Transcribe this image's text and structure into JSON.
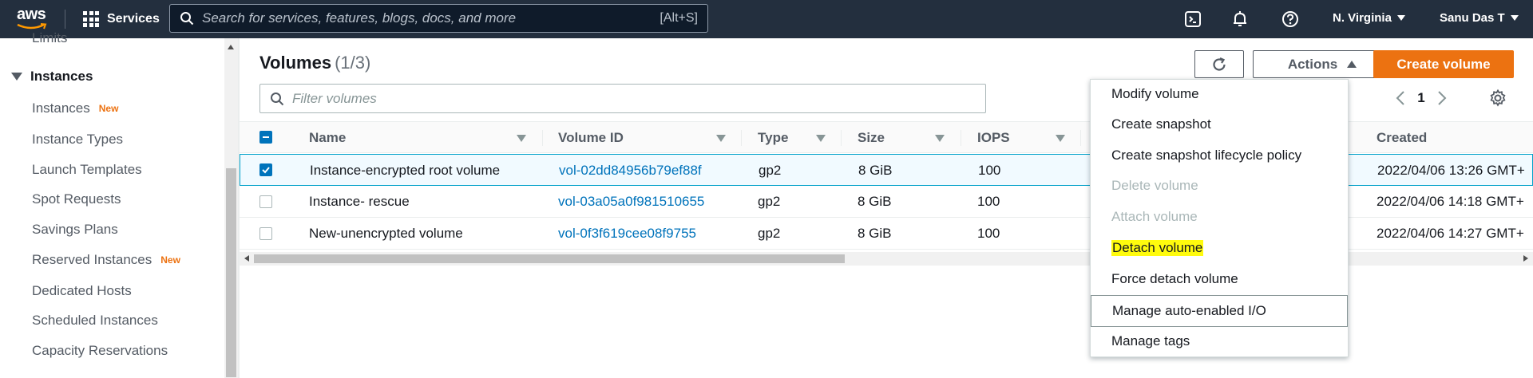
{
  "topnav": {
    "logo_text": "aws",
    "services_label": "Services",
    "search_placeholder": "Search for services, features, blogs, docs, and more",
    "search_shortcut": "[Alt+S]",
    "region": "N. Virginia",
    "user": "Sanu Das T"
  },
  "sidebar": {
    "cut_item": "Limits",
    "section_title": "Instances",
    "items": [
      {
        "label": "Instances",
        "badge": "New"
      },
      {
        "label": "Instance Types",
        "badge": ""
      },
      {
        "label": "Launch Templates",
        "badge": ""
      },
      {
        "label": "Spot Requests",
        "badge": ""
      },
      {
        "label": "Savings Plans",
        "badge": ""
      },
      {
        "label": "Reserved Instances",
        "badge": "New"
      },
      {
        "label": "Dedicated Hosts",
        "badge": ""
      },
      {
        "label": "Scheduled Instances",
        "badge": ""
      },
      {
        "label": "Capacity Reservations",
        "badge": ""
      }
    ]
  },
  "main": {
    "title": "Volumes",
    "count": "(1/3)",
    "actions_label": "Actions",
    "create_label": "Create volume",
    "filter_placeholder": "Filter volumes",
    "page_number": "1",
    "columns": [
      "Name",
      "Volume ID",
      "Type",
      "Size",
      "IOPS",
      "Created"
    ],
    "rows": [
      {
        "selected": true,
        "name": "Instance-encrypted root volume",
        "volume_id": "vol-02dd84956b79ef88f",
        "type": "gp2",
        "size": "8 GiB",
        "iops": "100",
        "created": "2022/04/06 13:26 GMT+"
      },
      {
        "selected": false,
        "name": "Instance- rescue",
        "volume_id": "vol-03a05a0f981510655",
        "type": "gp2",
        "size": "8 GiB",
        "iops": "100",
        "created": "2022/04/06 14:18 GMT+"
      },
      {
        "selected": false,
        "name": "New-unencrypted volume",
        "volume_id": "vol-0f3f619cee08f9755",
        "type": "gp2",
        "size": "8 GiB",
        "iops": "100",
        "created": "2022/04/06 14:27 GMT+"
      }
    ]
  },
  "actions_menu": [
    {
      "label": "Modify volume",
      "state": "enabled"
    },
    {
      "label": "Create snapshot",
      "state": "enabled"
    },
    {
      "label": "Create snapshot lifecycle policy",
      "state": "enabled"
    },
    {
      "label": "Delete volume",
      "state": "disabled"
    },
    {
      "label": "Attach volume",
      "state": "disabled"
    },
    {
      "label": "Detach volume",
      "state": "highlighted"
    },
    {
      "label": "Force detach volume",
      "state": "enabled"
    },
    {
      "label": "Manage auto-enabled I/O",
      "state": "hovered"
    },
    {
      "label": "Manage tags",
      "state": "enabled"
    }
  ],
  "colors": {
    "nav_bg": "#232f3e",
    "primary_orange": "#ec7211",
    "link_blue": "#0073bb",
    "selected_row_bg": "#f1faff",
    "highlight_yellow": "#fffb0d"
  },
  "icons": [
    "aws-logo-icon",
    "services-grid-icon",
    "search-icon",
    "cloudshell-icon",
    "notifications-bell-icon",
    "help-icon",
    "refresh-icon",
    "chevron-left-icon",
    "chevron-right-icon",
    "settings-gear-icon",
    "sort-caret-icon",
    "checkbox-check-icon"
  ]
}
